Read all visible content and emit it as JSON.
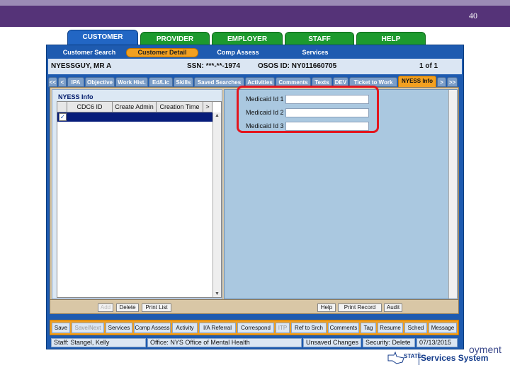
{
  "slide": {
    "number": "40"
  },
  "main_tabs": [
    {
      "label": "CUSTOMER",
      "active": true
    },
    {
      "label": "PROVIDER"
    },
    {
      "label": "EMPLOYER"
    },
    {
      "label": "STAFF"
    },
    {
      "label": "HELP"
    }
  ],
  "sub_nav": [
    {
      "label": "Customer Search"
    },
    {
      "label": "Customer Detail",
      "active": true
    },
    {
      "label": "Comp Assess"
    },
    {
      "label": "Services"
    }
  ],
  "customer": {
    "name": "NYESSGUY, MR A",
    "ssn": "SSN: ***-**-1974",
    "osos_id": "OSOS ID: NY011660705",
    "record": "1 of 1"
  },
  "detail_tabs": [
    {
      "label": "<<"
    },
    {
      "label": "<"
    },
    {
      "label": "IPA"
    },
    {
      "label": "Objective"
    },
    {
      "label": "Work Hist."
    },
    {
      "label": "Ed/Lic"
    },
    {
      "label": "Skills"
    },
    {
      "label": "Saved Searches"
    },
    {
      "label": "Activities"
    },
    {
      "label": "Comments"
    },
    {
      "label": "Texts"
    },
    {
      "label": "DEV"
    },
    {
      "label": "Ticket to Work"
    },
    {
      "label": "NYESS Info",
      "active": true
    },
    {
      "label": ">"
    },
    {
      "label": ">>"
    }
  ],
  "nyess_info": {
    "section_title": "NYESS Info",
    "columns": [
      "CDC6 ID",
      "Create Admin",
      "Creation Time",
      ">"
    ],
    "row_checked_icon": "checkmark-icon"
  },
  "medicaid": {
    "label1": "Medicaid Id 1",
    "label2": "Medicaid Id 2",
    "label3": "Medicaid Id 3",
    "value1": "",
    "value2": "",
    "value3": ""
  },
  "panel_buttons": {
    "add": "Add",
    "delete": "Delete",
    "print_list": "Print List",
    "help": "Help",
    "print_record": "Print Record",
    "audit": "Audit"
  },
  "actions": [
    {
      "label": "Save"
    },
    {
      "label": "Save/Next",
      "disabled": true
    },
    {
      "label": "Services"
    },
    {
      "label": "Comp Assess"
    },
    {
      "label": "Activity"
    },
    {
      "label": "I/A Referral"
    },
    {
      "label": "Correspond"
    },
    {
      "label": "ITP",
      "disabled": true
    },
    {
      "label": "Ref to Srch"
    },
    {
      "label": "Comments"
    },
    {
      "label": "Tag"
    },
    {
      "label": "Resume"
    },
    {
      "label": "Sched"
    },
    {
      "label": "Message"
    }
  ],
  "status": {
    "staff": "Staff: Stangel, Kelly",
    "office": "Office: NYS Office of Mental Health",
    "unsaved": "Unsaved Changes",
    "security": "Security: Delete",
    "date": "07/13/2015"
  },
  "branding": {
    "partial_text": "oyment",
    "state_small": "STATE",
    "system_name": "Services System"
  },
  "colors": {
    "header_purple": "#553378",
    "panel_blue": "#1e5bb0",
    "tab_green": "#1d9a2e",
    "accent_orange": "#f2a020",
    "highlight_red": "#e3161e"
  }
}
